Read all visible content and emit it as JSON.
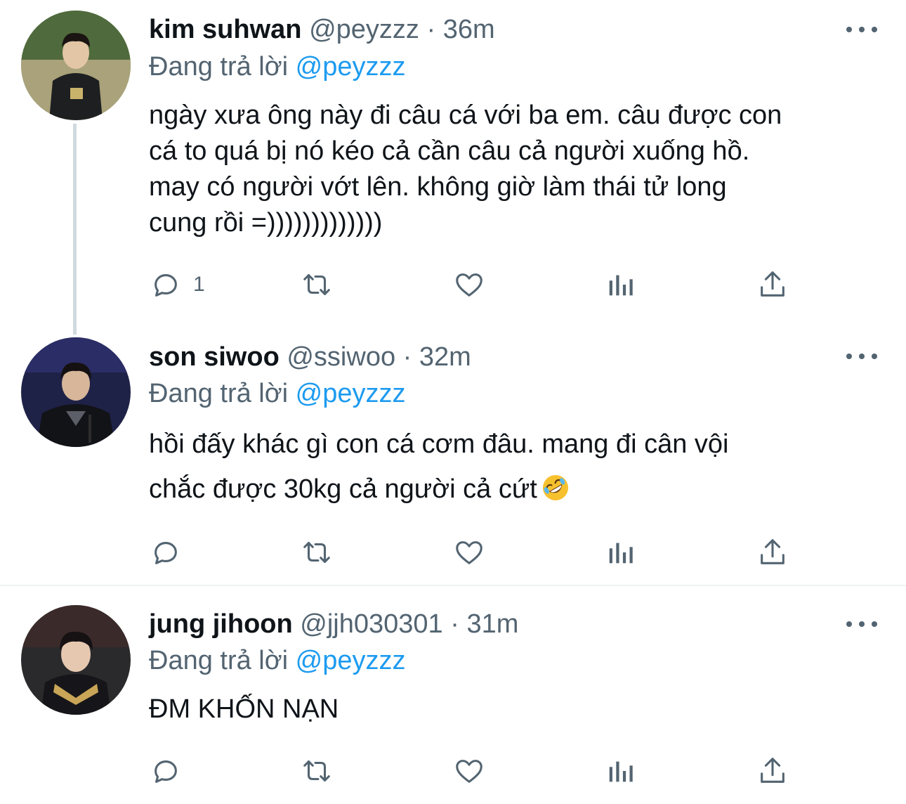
{
  "colors": {
    "text": "#0f1419",
    "muted": "#536471",
    "accent": "#1d9bf0",
    "thread_line": "#cfd9de",
    "divider": "#eff3f4"
  },
  "tweets": [
    {
      "name": "kim suhwan",
      "handle": "@peyzzz",
      "sep": "·",
      "time": "36m",
      "reply_prefix": "Đang trả lời",
      "reply_to": "@peyzzz",
      "lines": [
        "ngày xưa ông này đi câu cá với ba em. câu được con",
        "cá to quá bị nó kéo cả cần câu cả người xuống hồ.",
        "may có người vớt lên. không giờ làm thái tử long",
        "cung rồi =)))))))))))))"
      ],
      "reply_count": "1",
      "icons": [
        "reply-icon",
        "retweet-icon",
        "like-icon",
        "analytics-icon",
        "share-icon",
        "more-icon"
      ]
    },
    {
      "name": "son siwoo",
      "handle": "@ssiwoo",
      "sep": "·",
      "time": "32m",
      "reply_prefix": "Đang trả lời",
      "reply_to": "@peyzzz",
      "lines": [
        "hồi đấy khác gì con cá cơm đâu. mang đi cân vội",
        "chắc được 30kg cả người cả cứt"
      ],
      "emoji": "rolling-on-floor-laughing-emoji",
      "reply_count": ""
    },
    {
      "name": "jung jihoon",
      "handle": "@jjh030301",
      "sep": "·",
      "time": "31m",
      "reply_prefix": "Đang trả lời",
      "reply_to": "@peyzzz",
      "lines": [
        "ĐM KHỐN NẠN"
      ],
      "reply_count": ""
    }
  ]
}
